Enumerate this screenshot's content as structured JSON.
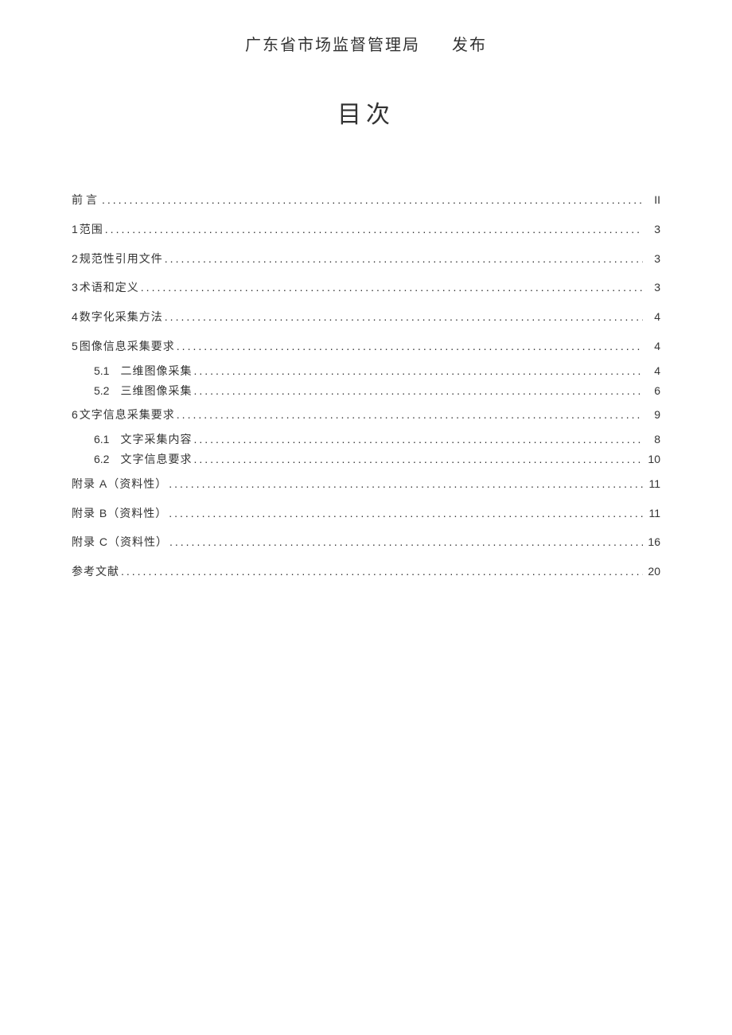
{
  "publisher": {
    "org": "广东省市场监督管理局",
    "action": "发布"
  },
  "tocTitle": "目次",
  "entries": [
    {
      "num": "",
      "label": "前言",
      "page": "II",
      "indent": 0,
      "spaced": true
    },
    {
      "num": "1",
      "label": "范围",
      "page": "3",
      "indent": 0
    },
    {
      "num": "2",
      "label": "规范性引用文件",
      "page": "3",
      "indent": 0
    },
    {
      "num": "3",
      "label": "术语和定义",
      "page": "3",
      "indent": 0
    },
    {
      "num": "4",
      "label": "数字化采集方法",
      "page": "4",
      "indent": 0
    },
    {
      "num": "5",
      "label": "图像信息采集要求",
      "page": "4",
      "indent": 0,
      "groupStart": true
    },
    {
      "num": "5.1",
      "label": "二维图像采集",
      "page": "4",
      "indent": 1
    },
    {
      "num": "5.2",
      "label": "三维图像采集",
      "page": "6",
      "indent": 1,
      "groupEnd": true
    },
    {
      "num": "6",
      "label": "文字信息采集要求",
      "page": "9",
      "indent": 0,
      "groupStart": true
    },
    {
      "num": "6.1",
      "label": "文字采集内容",
      "page": "8",
      "indent": 1
    },
    {
      "num": "6.2",
      "label": "文字信息要求",
      "page": "10",
      "indent": 1,
      "groupEnd": true
    },
    {
      "num": "",
      "label": "附录 A（资料性）",
      "page": "11",
      "indent": 0
    },
    {
      "num": "",
      "label": "附录 B（资料性）",
      "page": "11",
      "indent": 0
    },
    {
      "num": "",
      "label": "附录 C（资料性）",
      "page": "16",
      "indent": 0
    },
    {
      "num": "",
      "label": "参考文献",
      "page": "20",
      "indent": 0
    }
  ]
}
